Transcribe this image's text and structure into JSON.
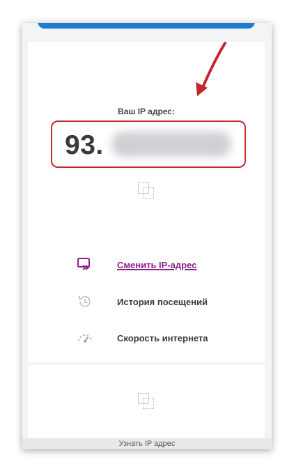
{
  "ip_section": {
    "label": "Ваш IP адрес:",
    "ip_visible_prefix": "93."
  },
  "menu": {
    "items": [
      {
        "label": "Сменить IP-адрес",
        "icon": "change-ip-icon",
        "active": true
      },
      {
        "label": "История посещений",
        "icon": "history-icon",
        "active": false
      },
      {
        "label": "Скорость интернета",
        "icon": "speedometer-icon",
        "active": false
      }
    ]
  },
  "bottom_bar": {
    "title": "Узнать IP адрес"
  },
  "colors": {
    "accent_blue": "#1e7cd1",
    "highlight_red": "#c3272e",
    "link_purple": "#8b1e8f"
  }
}
